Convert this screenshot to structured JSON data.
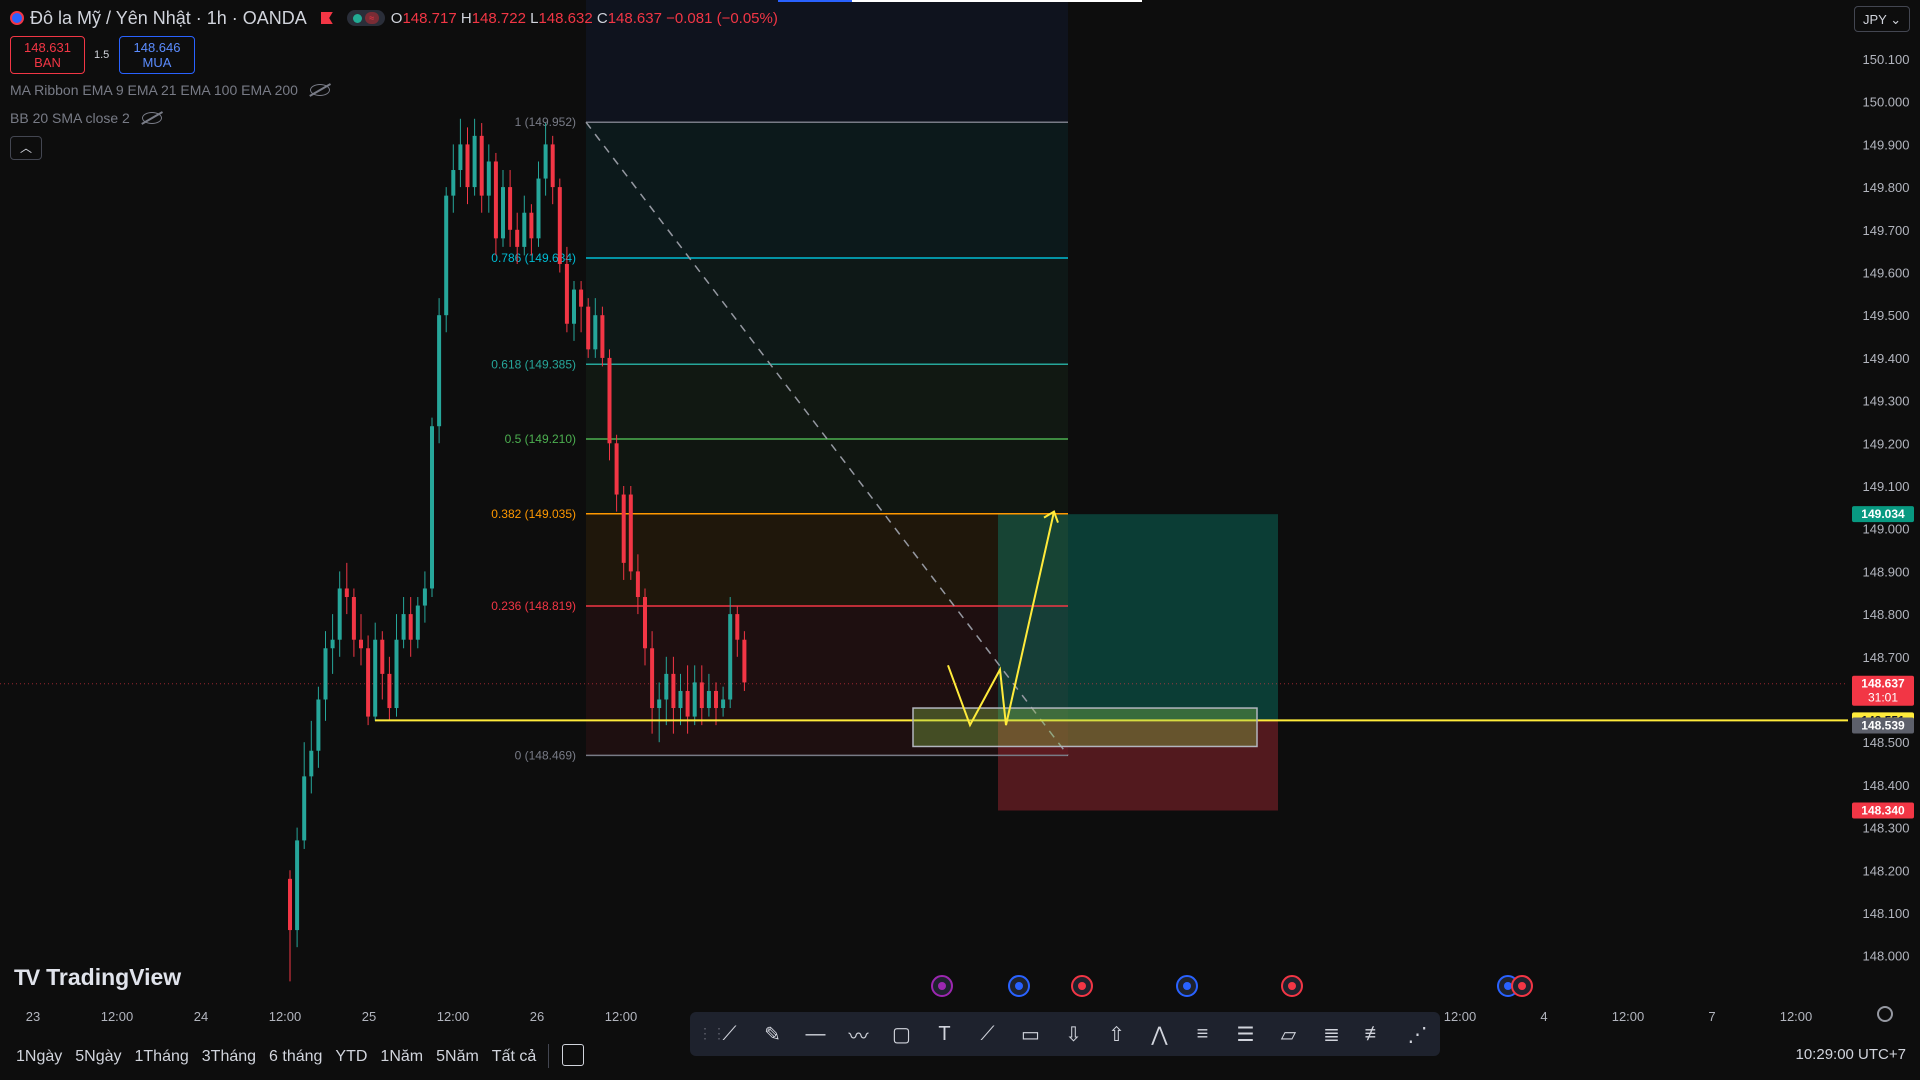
{
  "header": {
    "title": "Đô la Mỹ / Yên Nhật · 1h · OANDA",
    "open_label": "O",
    "open": "148.717",
    "high_label": "H",
    "high": "148.722",
    "low_label": "L",
    "low": "148.632",
    "close_label": "C",
    "close": "148.637",
    "change": "−0.081 (−0.05%)"
  },
  "trade": {
    "sell_price": "148.631",
    "sell_label": "BAN",
    "spread": "1.5",
    "buy_price": "148.646",
    "buy_label": "MUA"
  },
  "indicators": {
    "ma_ribbon": "MA Ribbon EMA 9 EMA 21 EMA 100 EMA 200",
    "bb": "BB 20 SMA close 2"
  },
  "currency": "JPY",
  "brand": "TradingView",
  "timeframes": [
    "1Ngày",
    "5Ngày",
    "1Tháng",
    "3Tháng",
    "6 tháng",
    "YTD",
    "1Năm",
    "5Năm",
    "Tất cả"
  ],
  "clock": "10:29:00 UTC+7",
  "toolbar_icons": [
    "trend-line-icon",
    "brush-icon",
    "horizontal-line-icon",
    "path-icon",
    "rectangle-icon",
    "text-icon",
    "ray-icon",
    "callout-icon",
    "arrow-down-icon",
    "arrow-up-icon",
    "abcd-pattern-icon",
    "fib-retracement-icon",
    "fib-channel-icon",
    "comment-icon",
    "parallel-channel-icon",
    "regression-icon",
    "elliott-wave-icon"
  ],
  "colors": {
    "up": "#26a69a",
    "down": "#f23645",
    "yellow": "#ffeb3b",
    "fib_0786": "#00bcd4",
    "fib_0618": "#26a69a",
    "fib_05": "#4caf50",
    "fib_0382": "#ff9800",
    "fib_0236": "#f23645",
    "fib_edge": "#787b86"
  },
  "chart_data": {
    "type": "candlestick",
    "symbol": "USDJPY",
    "ylim": [
      147.93,
      150.19
    ],
    "y_ticks": [
      "150.100",
      "150.000",
      "149.900",
      "149.800",
      "149.700",
      "149.600",
      "149.500",
      "149.400",
      "149.300",
      "149.200",
      "149.100",
      "149.000",
      "148.900",
      "148.800",
      "148.700",
      "148.600",
      "148.500",
      "148.400",
      "148.300",
      "148.200",
      "148.100",
      "148.000"
    ],
    "x_ticks": [
      "23",
      "12:00",
      "24",
      "12:00",
      "25",
      "12:00",
      "26",
      "12:00",
      "12:00",
      "4",
      "12:00",
      "7",
      "12:00"
    ],
    "price_labels": [
      {
        "value": 149.034,
        "text": "149.034",
        "color": "#089981"
      },
      {
        "value": 148.637,
        "text": "148.637",
        "sub": "31:01",
        "color": "#f23645"
      },
      {
        "value": 148.551,
        "text": "148.551",
        "color": "#ffeb3b"
      },
      {
        "value": 148.539,
        "text": "148.539",
        "color": "#5d606b"
      },
      {
        "value": 148.34,
        "text": "148.340",
        "color": "#f23645"
      }
    ],
    "fib_levels": [
      {
        "ratio": "1",
        "price": 149.952,
        "label": "1 (149.952)"
      },
      {
        "ratio": "0.786",
        "price": 149.634,
        "label": "0.786 (149.634)"
      },
      {
        "ratio": "0.618",
        "price": 149.385,
        "label": "0.618 (149.385)"
      },
      {
        "ratio": "0.5",
        "price": 149.21,
        "label": "0.5 (149.210)"
      },
      {
        "ratio": "0.382",
        "price": 149.035,
        "label": "0.382 (149.035)"
      },
      {
        "ratio": "0.236",
        "price": 148.819,
        "label": "0.236 (148.819)"
      },
      {
        "ratio": "0",
        "price": 148.469,
        "label": "0 (148.469)"
      }
    ],
    "support_line": 148.551,
    "position": {
      "entry": 148.551,
      "target": 149.034,
      "stop": 148.34
    },
    "demand_zone": [
      148.49,
      148.58
    ],
    "projection_path": [
      148.68,
      148.54,
      148.67,
      148.54,
      149.04
    ],
    "candles": [
      [
        148.18,
        148.06,
        148.2,
        147.94
      ],
      [
        148.06,
        148.27,
        148.3,
        148.02
      ],
      [
        148.27,
        148.42,
        148.5,
        148.25
      ],
      [
        148.42,
        148.48,
        148.55,
        148.38
      ],
      [
        148.48,
        148.6,
        148.63,
        148.44
      ],
      [
        148.6,
        148.72,
        148.76,
        148.55
      ],
      [
        148.72,
        148.74,
        148.8,
        148.66
      ],
      [
        148.74,
        148.86,
        148.9,
        148.7
      ],
      [
        148.86,
        148.84,
        148.92,
        148.8
      ],
      [
        148.84,
        148.74,
        148.86,
        148.7
      ],
      [
        148.74,
        148.72,
        148.8,
        148.68
      ],
      [
        148.72,
        148.56,
        148.75,
        148.54
      ],
      [
        148.56,
        148.74,
        148.78,
        148.55
      ],
      [
        148.74,
        148.66,
        148.76,
        148.6
      ],
      [
        148.66,
        148.58,
        148.7,
        148.55
      ],
      [
        148.58,
        148.74,
        148.8,
        148.56
      ],
      [
        148.74,
        148.8,
        148.84,
        148.72
      ],
      [
        148.8,
        148.74,
        148.84,
        148.7
      ],
      [
        148.74,
        148.82,
        148.84,
        148.72
      ],
      [
        148.82,
        148.86,
        148.9,
        148.78
      ],
      [
        148.86,
        149.24,
        149.26,
        148.84
      ],
      [
        149.24,
        149.5,
        149.54,
        149.2
      ],
      [
        149.5,
        149.78,
        149.8,
        149.46
      ],
      [
        149.78,
        149.84,
        149.9,
        149.74
      ],
      [
        149.84,
        149.9,
        149.96,
        149.8
      ],
      [
        149.9,
        149.8,
        149.94,
        149.76
      ],
      [
        149.8,
        149.92,
        149.96,
        149.78
      ],
      [
        149.92,
        149.78,
        149.95,
        149.74
      ],
      [
        149.78,
        149.86,
        149.9,
        149.74
      ],
      [
        149.86,
        149.68,
        149.88,
        149.64
      ],
      [
        149.68,
        149.8,
        149.84,
        149.66
      ],
      [
        149.8,
        149.7,
        149.84,
        149.66
      ],
      [
        149.7,
        149.66,
        149.74,
        149.62
      ],
      [
        149.66,
        149.74,
        149.78,
        149.64
      ],
      [
        149.74,
        149.68,
        149.76,
        149.64
      ],
      [
        149.68,
        149.82,
        149.86,
        149.66
      ],
      [
        149.82,
        149.9,
        149.95,
        149.78
      ],
      [
        149.9,
        149.8,
        149.92,
        149.76
      ],
      [
        149.8,
        149.62,
        149.82,
        149.6
      ],
      [
        149.62,
        149.48,
        149.66,
        149.46
      ],
      [
        149.48,
        149.56,
        149.58,
        149.44
      ],
      [
        149.56,
        149.52,
        149.58,
        149.46
      ],
      [
        149.52,
        149.42,
        149.54,
        149.4
      ],
      [
        149.42,
        149.5,
        149.54,
        149.4
      ],
      [
        149.5,
        149.4,
        149.52,
        149.38
      ],
      [
        149.4,
        149.2,
        149.42,
        149.16
      ],
      [
        149.2,
        149.08,
        149.22,
        149.04
      ],
      [
        149.08,
        148.92,
        149.1,
        148.88
      ],
      [
        149.08,
        148.9,
        149.1,
        148.88
      ],
      [
        148.9,
        148.84,
        148.94,
        148.8
      ],
      [
        148.84,
        148.72,
        148.86,
        148.68
      ],
      [
        148.72,
        148.58,
        148.76,
        148.52
      ],
      [
        148.58,
        148.6,
        148.64,
        148.5
      ],
      [
        148.6,
        148.66,
        148.7,
        148.54
      ],
      [
        148.66,
        148.58,
        148.7,
        148.52
      ],
      [
        148.58,
        148.62,
        148.66,
        148.54
      ],
      [
        148.62,
        148.56,
        148.68,
        148.52
      ],
      [
        148.56,
        148.64,
        148.68,
        148.54
      ],
      [
        148.64,
        148.58,
        148.68,
        148.54
      ],
      [
        148.58,
        148.62,
        148.66,
        148.56
      ],
      [
        148.62,
        148.58,
        148.64,
        148.54
      ],
      [
        148.58,
        148.6,
        148.63,
        148.56
      ],
      [
        148.6,
        148.8,
        148.84,
        148.58
      ],
      [
        148.8,
        148.74,
        148.82,
        148.7
      ],
      [
        148.74,
        148.64,
        148.76,
        148.62
      ]
    ]
  }
}
